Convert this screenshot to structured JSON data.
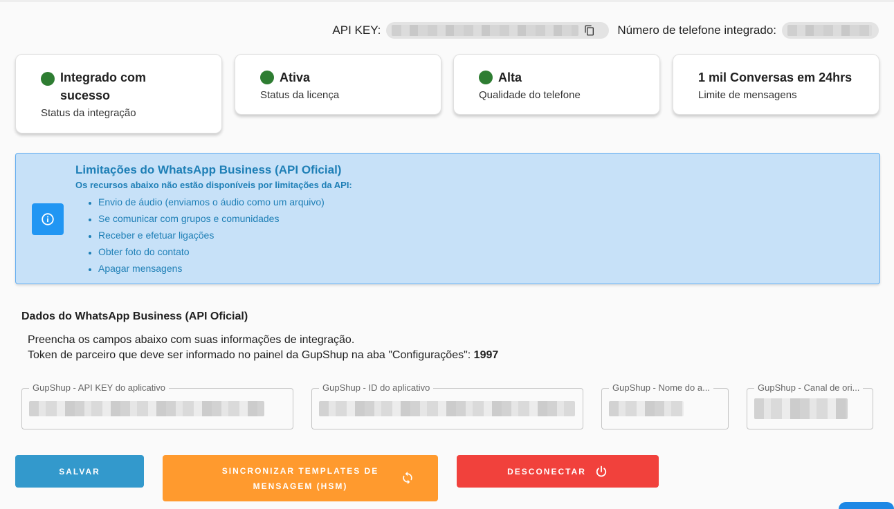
{
  "header": {
    "api_key_label": "API KEY:",
    "phone_label": "Número de telefone integrado:"
  },
  "cards": [
    {
      "title": "Integrado com sucesso",
      "subtitle": "Status da integração",
      "status_color": "#2e7d32"
    },
    {
      "title": "Ativa",
      "subtitle": "Status da licença",
      "status_color": "#2e7d32"
    },
    {
      "title": "Alta",
      "subtitle": "Qualidade do telefone",
      "status_color": "#2e7d32"
    },
    {
      "title": "1 mil Conversas em 24hrs",
      "subtitle": "Limite de mensagens"
    }
  ],
  "alert": {
    "title": "Limitações do WhatsApp Business (API Oficial)",
    "subtitle": "Os recursos abaixo não estão disponíveis por limitações da API:",
    "items": [
      "Envio de áudio (enviamos o áudio como um arquivo)",
      "Se comunicar com grupos e comunidades",
      "Receber e efetuar ligações",
      "Obter foto do contato",
      "Apagar mensagens"
    ]
  },
  "section": {
    "title": "Dados do WhatsApp Business (API Oficial)",
    "desc_line1": "Preencha os campos abaixo com suas informações de integração.",
    "desc_line2": "Token de parceiro que deve ser informado no painel da GupShup na aba \"Configurações\": ",
    "token": "1997"
  },
  "fields": [
    {
      "label": "GupShup - API KEY do aplicativo"
    },
    {
      "label": "GupShup - ID do aplicativo"
    },
    {
      "label": "GupShup - Nome do a..."
    },
    {
      "label": "GupShup - Canal de ori..."
    }
  ],
  "buttons": {
    "save": "SALVAR",
    "sync_line1": "SINCRONIZAR TEMPLATES DE",
    "sync_line2": "MENSAGEM (HSM)",
    "disconnect": "DESCONECTAR"
  },
  "colors": {
    "save": "#3399cc",
    "sync": "#ff9a2e",
    "disconnect": "#f1413c",
    "alert_bg": "#c7e1f8",
    "alert_text": "#1e7fb6"
  }
}
